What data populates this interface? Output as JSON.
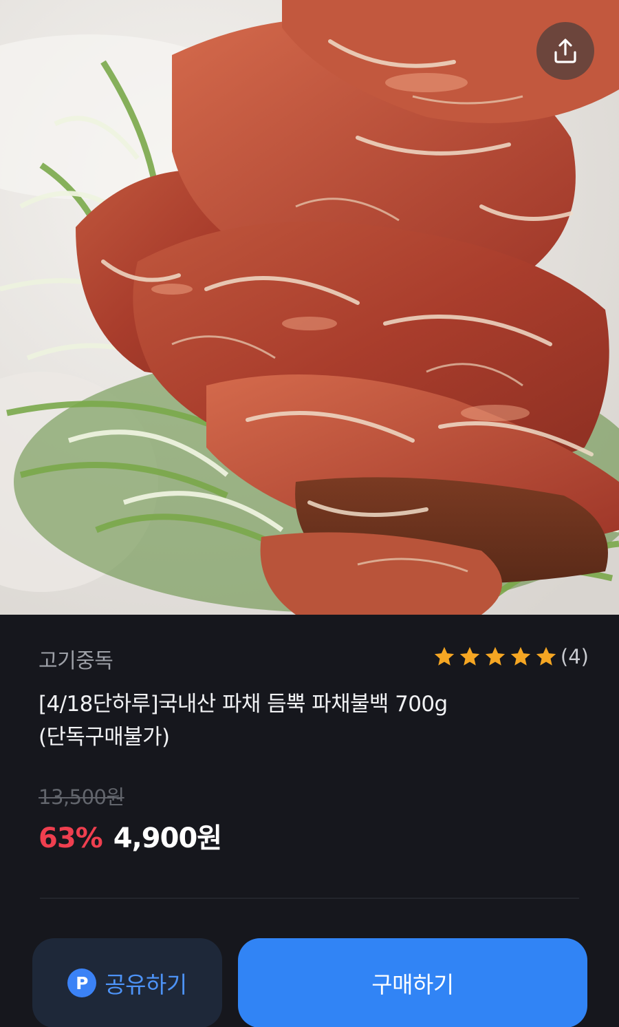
{
  "product": {
    "seller": "고기중독",
    "rating_stars": 5,
    "review_count": "(4)",
    "title_line1": "[4/18단하루]국내산 파채 듬뿍 파채불백 700g",
    "title_line2": "(단독구매불가)",
    "original_price": "13,500원",
    "discount": "63%",
    "sale_price": "4,900원"
  },
  "buttons": {
    "share_label": "공유하기",
    "share_badge": "P",
    "buy_label": "구매하기"
  },
  "icons": {
    "share": "share-upload-icon",
    "star": "star-icon"
  },
  "colors": {
    "background": "#16171d",
    "accent_blue": "#3184f5",
    "discount_red": "#ef3f4f",
    "star_orange": "#f5a623"
  }
}
